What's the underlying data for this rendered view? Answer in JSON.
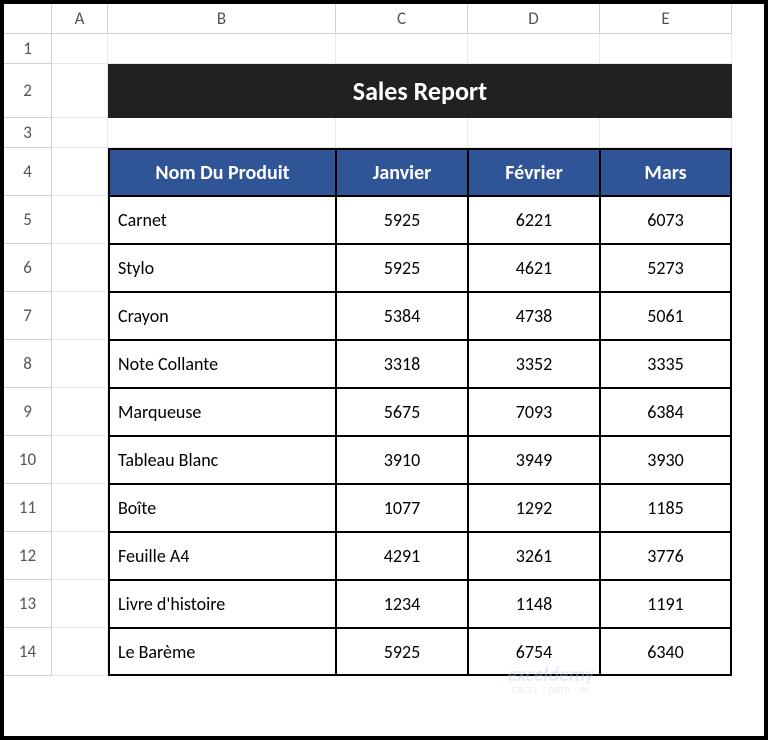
{
  "columns": [
    "A",
    "B",
    "C",
    "D",
    "E"
  ],
  "rows": [
    "1",
    "2",
    "3",
    "4",
    "5",
    "6",
    "7",
    "8",
    "9",
    "10",
    "11",
    "12",
    "13",
    "14"
  ],
  "title": "Sales Report",
  "table": {
    "headers": [
      "Nom Du Produit",
      "Janvier",
      "Février",
      "Mars"
    ],
    "data": [
      {
        "name": "Carnet",
        "jan": "5925",
        "feb": "6221",
        "mar": "6073"
      },
      {
        "name": "Stylo",
        "jan": "5925",
        "feb": "4621",
        "mar": "5273"
      },
      {
        "name": "Crayon",
        "jan": "5384",
        "feb": "4738",
        "mar": "5061"
      },
      {
        "name": "Note Collante",
        "jan": "3318",
        "feb": "3352",
        "mar": "3335"
      },
      {
        "name": "Marqueuse",
        "jan": "5675",
        "feb": "7093",
        "mar": "6384"
      },
      {
        "name": "Tableau Blanc",
        "jan": "3910",
        "feb": "3949",
        "mar": "3930"
      },
      {
        "name": "Boîte",
        "jan": "1077",
        "feb": "1292",
        "mar": "1185"
      },
      {
        "name": "Feuille A4",
        "jan": "4291",
        "feb": "3261",
        "mar": "3776"
      },
      {
        "name": "Livre d'histoire",
        "jan": "1234",
        "feb": "1148",
        "mar": "1191"
      },
      {
        "name": "Le Barème",
        "jan": "5925",
        "feb": "6754",
        "mar": "6340"
      }
    ]
  },
  "watermark": {
    "main": "exceldemy",
    "sub": "EXCEL · DATA · BI"
  }
}
